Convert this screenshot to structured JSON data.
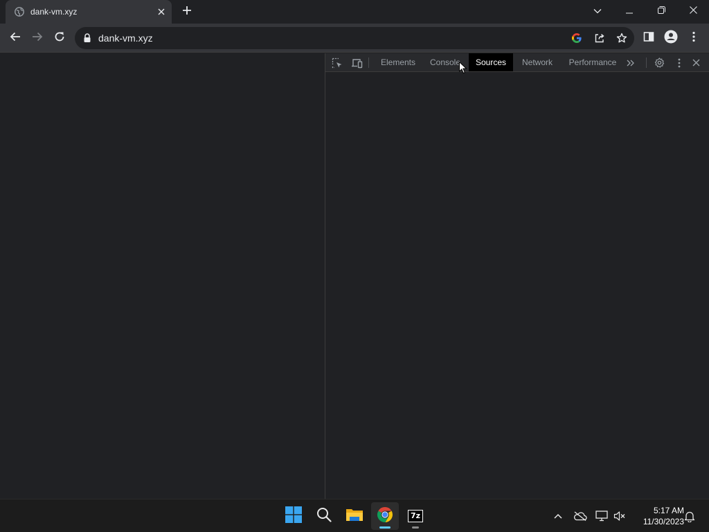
{
  "browser": {
    "tab": {
      "title": "dank-vm.xyz",
      "favicon": "globe-icon",
      "close_icon": "close-icon"
    },
    "new_tab_icon": "plus-icon",
    "window_controls": [
      "tab-search-icon",
      "minimize-icon",
      "restore-icon",
      "close-icon"
    ],
    "toolbar": {
      "back_icon": "arrow-left-icon",
      "forward_icon": "arrow-right-icon",
      "reload_icon": "reload-icon",
      "url": "dank-vm.xyz",
      "lock_icon": "lock-icon",
      "omnibox_icons": [
        "google-lens-icon",
        "share-icon",
        "star-icon"
      ],
      "side_panel_icon": "side-panel-icon",
      "profile_icon": "profile-icon",
      "menu_icon": "kebab-menu-icon"
    }
  },
  "devtools": {
    "tool_icons": [
      "inspect-element-icon",
      "device-toolbar-icon"
    ],
    "tabs": [
      {
        "label": "Elements",
        "active": false
      },
      {
        "label": "Console",
        "active": false
      },
      {
        "label": "Sources",
        "active": true
      },
      {
        "label": "Network",
        "active": false
      },
      {
        "label": "Performance",
        "active": false
      }
    ],
    "more_tabs_icon": "chevron-double-right-icon",
    "settings_icon": "gear-icon",
    "menu_icon": "kebab-menu-icon",
    "close_icon": "close-icon"
  },
  "taskbar": {
    "apps": [
      {
        "name": "start",
        "icon": "windows-logo-icon"
      },
      {
        "name": "search",
        "icon": "search-icon"
      },
      {
        "name": "file-explorer",
        "icon": "folder-icon"
      },
      {
        "name": "chrome",
        "icon": "chrome-icon",
        "active": true
      },
      {
        "name": "7-zip",
        "icon": "7zip-icon",
        "label": "7z"
      }
    ],
    "tray_icons": [
      "chevron-up-icon",
      "onedrive-offline-icon",
      "network-icon",
      "volume-muted-icon"
    ],
    "clock": {
      "time": "5:17 AM",
      "date": "11/30/2023"
    },
    "notification_icon": "bell-icon"
  },
  "colors": {
    "background": "#202124",
    "toolbar": "#35363a",
    "devtools_bar": "#292a2d",
    "active_tab": "#000000",
    "taskbar": "#1c1c1c",
    "accent": "#60cdff"
  }
}
